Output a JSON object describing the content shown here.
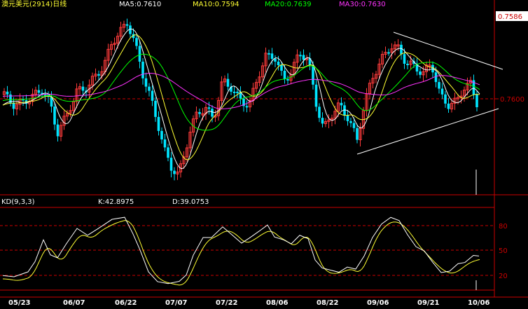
{
  "header": {
    "title": "澳元美元(2914)日线",
    "ma5": "MA5:0.7610",
    "ma10": "MA10:0.7594",
    "ma20": "MA20:0.7639",
    "ma30": "MA30:0.7630"
  },
  "kd_header": {
    "title": "KD(9,3,3)",
    "k": "K:42.8975",
    "d": "D:39.0753"
  },
  "price_labels": {
    "top": "0.7586",
    "mid": "0.7600"
  },
  "kd_labels": [
    "80",
    "50",
    "20"
  ],
  "x_labels": [
    "05/23",
    "06/07",
    "06/22",
    "07/07",
    "07/22",
    "08/06",
    "08/22",
    "09/06",
    "09/21",
    "10/06"
  ],
  "colors": {
    "up": "#ff3b3b",
    "down": "#00e5ff",
    "ma5": "#ffffff",
    "ma10": "#ffff33",
    "ma20": "#00ff00",
    "ma30": "#ff33ff",
    "k": "#ffffff",
    "d": "#ffff33",
    "dashed": "#cc0000",
    "axis": "#cc0000"
  },
  "chart_data": {
    "type": "candlestick",
    "title": "澳元美元(2914)日线",
    "x_ticks": [
      "05/23",
      "06/07",
      "06/22",
      "07/07",
      "07/22",
      "08/06",
      "08/22",
      "09/06",
      "09/21",
      "10/06"
    ],
    "price_reference": [
      0.7586,
      0.76
    ],
    "ma_current": {
      "MA5": 0.761,
      "MA10": 0.7594,
      "MA20": 0.7639,
      "MA30": 0.763
    },
    "kd": {
      "params": "9,3,3",
      "K": 42.8975,
      "D": 39.0753,
      "levels": [
        80,
        50,
        20
      ]
    }
  }
}
